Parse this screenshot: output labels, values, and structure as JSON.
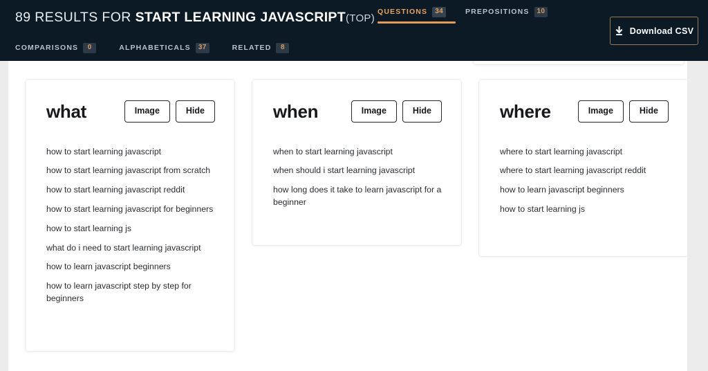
{
  "header": {
    "title": {
      "count": "89 RESULTS FOR ",
      "keyword": "START LEARNING JAVASCRIPT",
      "sort": "(TOP)"
    },
    "download_label": "Download CSV",
    "colors": {
      "bar_background": "#0c1a26",
      "accent_orange": "#e89a4e",
      "tab_inactive": "#b9c3cb",
      "badge_background": "#2b3a46",
      "button_border": "#9a7a52"
    },
    "tabs_top": [
      {
        "label": "QUESTIONS",
        "count": "34",
        "active": true
      },
      {
        "label": "PREPOSITIONS",
        "count": "10",
        "active": false
      }
    ],
    "tabs_bottom": [
      {
        "label": "COMPARISONS",
        "count": "0",
        "active": false
      },
      {
        "label": "ALPHABETICALS",
        "count": "37",
        "active": false
      },
      {
        "label": "RELATED",
        "count": "8",
        "active": false
      }
    ]
  },
  "cards": [
    {
      "title": "what",
      "image_label": "Image",
      "hide_label": "Hide",
      "suggestions": [
        "how to start learning javascript",
        "how to start learning javascript from scratch",
        "how to start learning javascript reddit",
        "how to start learning javascript for beginners",
        "how to start learning js",
        "what do i need to start learning javascript",
        "how to learn javascript beginners",
        "how to learn javascript step by step for beginners"
      ]
    },
    {
      "title": "when",
      "image_label": "Image",
      "hide_label": "Hide",
      "suggestions": [
        "when to start learning javascript",
        "when should i start learning javascript",
        "how long does it take to learn javascript for a beginner"
      ]
    },
    {
      "title": "where",
      "image_label": "Image",
      "hide_label": "Hide",
      "suggestions": [
        "where to start learning javascript",
        "where to start learning javascript reddit",
        "how to learn javascript beginners",
        "how to start learning js"
      ]
    }
  ]
}
